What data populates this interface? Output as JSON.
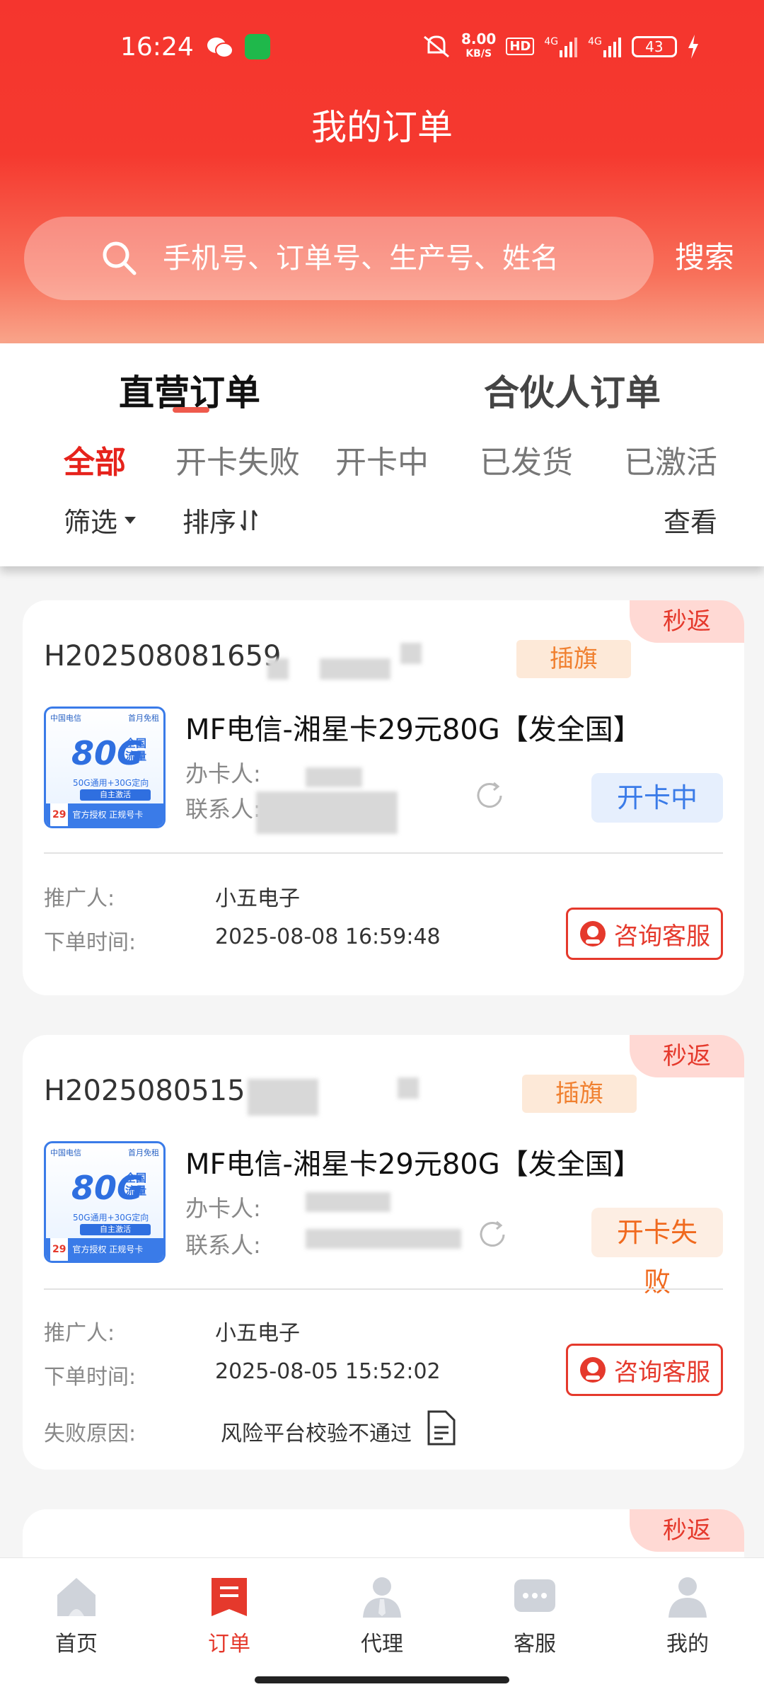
{
  "status_bar": {
    "time": "16:24",
    "speed_value": "8.00",
    "speed_unit": "KB/S",
    "hd": "HD",
    "net1": "4G",
    "net2": "4G",
    "battery": "43"
  },
  "header": {
    "title": "我的订单",
    "search_placeholder": "手机号、订单号、生产号、姓名",
    "search_button": "搜索"
  },
  "main_tabs": [
    {
      "label": "直营订单",
      "active": true
    },
    {
      "label": "合伙人订单",
      "active": false
    }
  ],
  "status_tabs": [
    "全部",
    "开卡失败",
    "开卡中",
    "已发货",
    "已激活"
  ],
  "filters": {
    "filter_label": "筛选",
    "sort_label": "排序",
    "view_label": "查看"
  },
  "orders": [
    {
      "flag": "秒返",
      "order_no_prefix": "H2025080816",
      "order_no_visible": "H202508081659",
      "tag": "插旗",
      "thumb": {
        "brand": "中国电信",
        "title": "80G",
        "sub1": "全国",
        "sub2": "流量",
        "line1": "50G通用+30G定向",
        "line2": "自主激活",
        "price": "29",
        "unit": "元/月",
        "footer": "官方授权 正规号卡",
        "corner": "首月免租"
      },
      "product": "MF电信-湘星卡29元80G【发全国】",
      "holder_label": "办卡人:",
      "contact_label": "联系人:",
      "status": "开卡中",
      "promoter_label": "推广人:",
      "promoter": "小五电子",
      "time_label": "下单时间:",
      "time": "2025-08-08 16:59:48",
      "consult": "咨询客服"
    },
    {
      "flag": "秒返",
      "order_no_visible": "H2025080515",
      "tag": "插旗",
      "thumb": {
        "brand": "中国电信",
        "title": "80G",
        "sub1": "全国",
        "sub2": "流量",
        "line1": "50G通用+30G定向",
        "line2": "自主激活",
        "price": "29",
        "unit": "元/月",
        "footer": "官方授权 正规号卡",
        "corner": "首月免租"
      },
      "product": "MF电信-湘星卡29元80G【发全国】",
      "holder_label": "办卡人:",
      "contact_label": "联系人:",
      "status": "开卡失败",
      "promoter_label": "推广人:",
      "promoter": "小五电子",
      "time_label": "下单时间:",
      "time": "2025-08-05 15:52:02",
      "fail_label": "失败原因:",
      "fail_reason": "风险平台校验不通过",
      "consult": "咨询客服"
    },
    {
      "flag": "秒返"
    }
  ],
  "bottom_nav": [
    {
      "label": "首页",
      "icon": "home-icon",
      "active": false
    },
    {
      "label": "订单",
      "icon": "order-icon",
      "active": true
    },
    {
      "label": "代理",
      "icon": "agent-icon",
      "active": false
    },
    {
      "label": "客服",
      "icon": "chat-icon",
      "active": false
    },
    {
      "label": "我的",
      "icon": "profile-icon",
      "active": false
    }
  ],
  "colors": {
    "brand_red": "#e5392c",
    "opening_blue": "#3a7be8",
    "failed_orange": "#f06a1f"
  }
}
